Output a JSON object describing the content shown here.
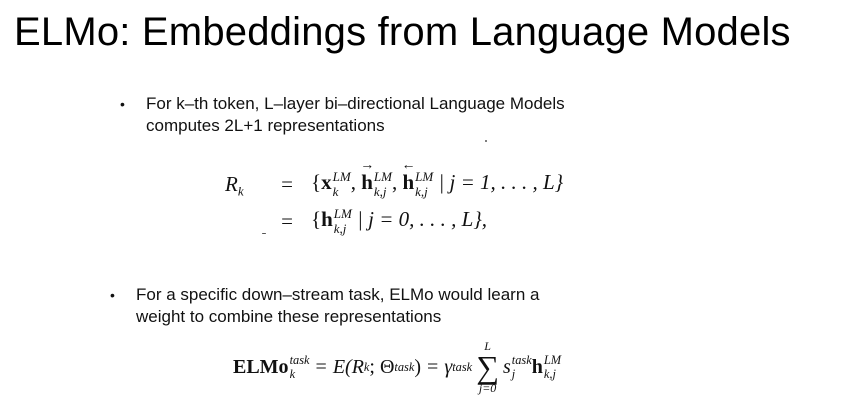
{
  "slide": {
    "title": "ELMo: Embeddings from Language Models",
    "bullet_symbol": "•",
    "bullet1": {
      "line1": "For k–th token, L–layer bi–directional Language Models",
      "line2": "computes 2L+1 representations"
    },
    "bullet2": {
      "line1": "For a specific down–stream task, ELMo would learn a",
      "line2": "weight to combine these representations"
    },
    "equation1": {
      "lhs": "R",
      "lhs_sub": "k",
      "eq": "=",
      "line1_open": "{",
      "x": "x",
      "x_sup": "LM",
      "x_sub": "k",
      "comma": ",",
      "h": "h",
      "h_fwd_arrow": "→",
      "h_bwd_arrow": "←",
      "h_sup": "LM",
      "h_sub": "k,j",
      "cond1": "| j = 1, . . . , L}",
      "line2_open": "{",
      "h2": "h",
      "h2_sup": "LM",
      "h2_sub": "k,j",
      "cond2": "| j = 0, . . . , L},"
    },
    "equation2": {
      "lhs": "ELMo",
      "lhs_sup": "task",
      "lhs_sub": "k",
      "eq1": "=",
      "E": "E(R",
      "E_sub": "k",
      "theta": "; Θ",
      "theta_sup": "task",
      "close": ")",
      "eq2": "=",
      "gamma": "γ",
      "gamma_sup": "task",
      "sum_top": "L",
      "sum_sign": "∑",
      "sum_bottom": "j=0",
      "s": "s",
      "s_sup": "task",
      "s_sub": "j",
      "h": "h",
      "h_sup": "LM",
      "h_sub": "k,j"
    }
  }
}
